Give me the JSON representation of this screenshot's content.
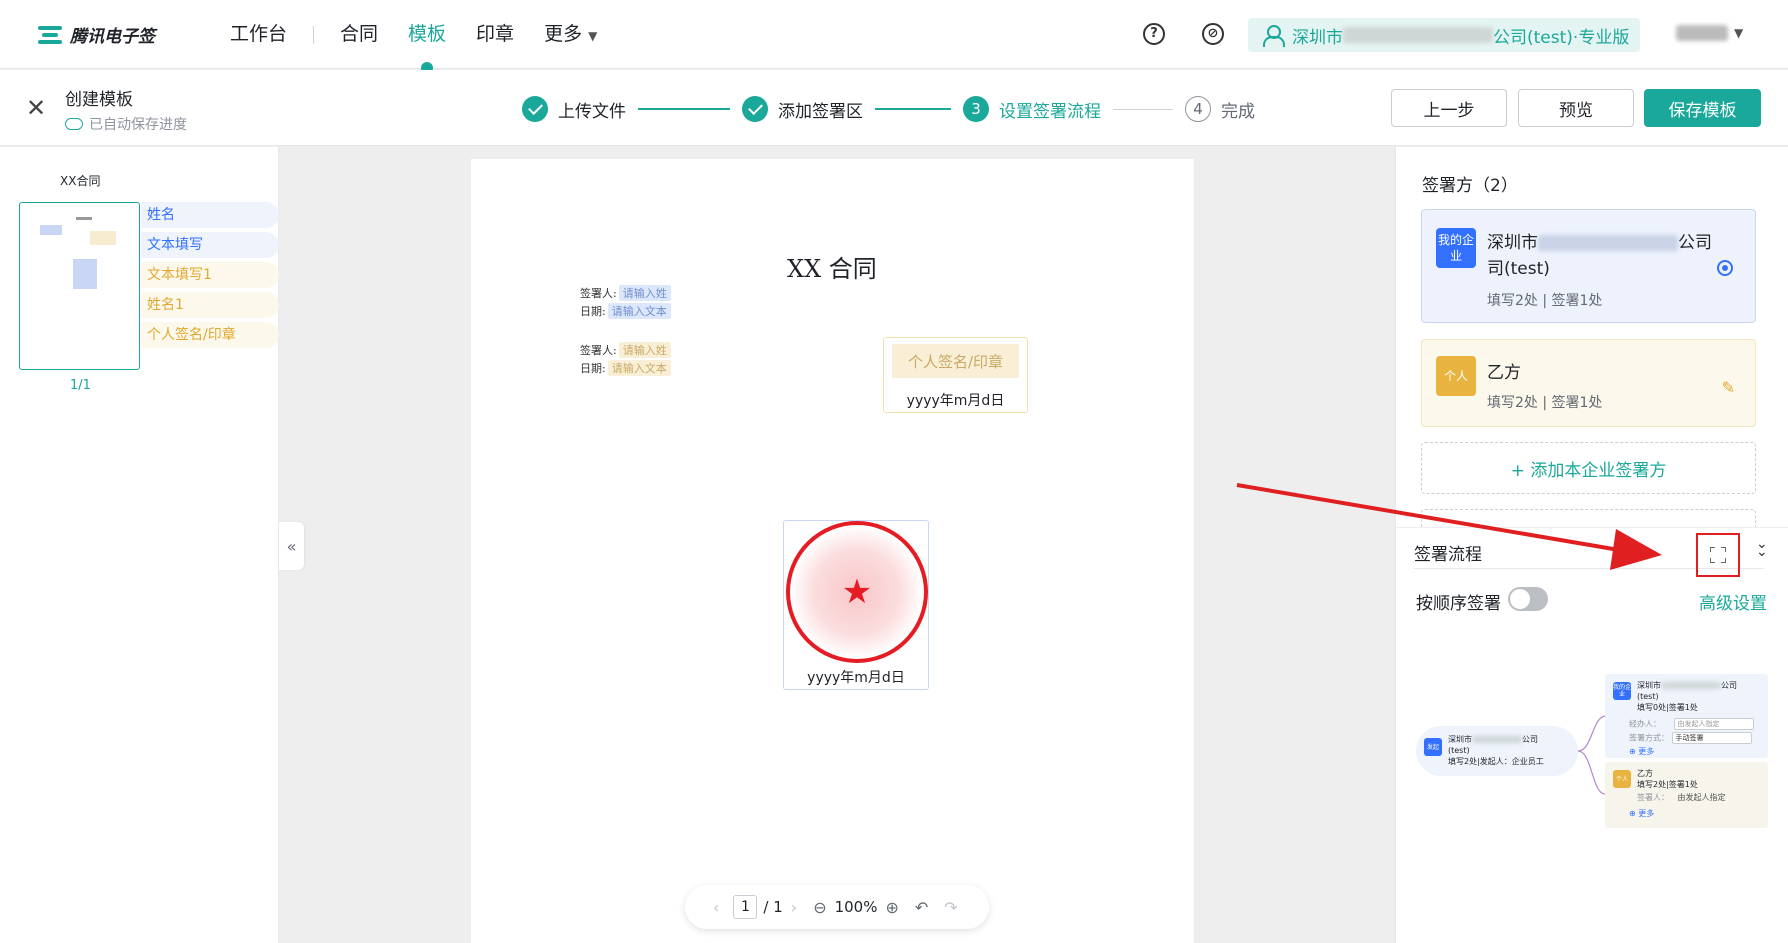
{
  "nav": {
    "logo_text": "腾讯电子签",
    "links": [
      "工作台",
      "合同",
      "模板",
      "印章",
      "更多"
    ],
    "active": "模板",
    "company_prefix": "深圳市",
    "company_suffix": "公司(test)·专业版"
  },
  "subheader": {
    "title": "创建模板",
    "autosave": "已自动保存进度",
    "steps": [
      {
        "num": "",
        "label": "上传文件",
        "state": "done"
      },
      {
        "num": "",
        "label": "添加签署区",
        "state": "done"
      },
      {
        "num": "3",
        "label": "设置签署流程",
        "state": "current"
      },
      {
        "num": "4",
        "label": "完成",
        "state": "todo"
      }
    ],
    "buttons": {
      "prev": "上一步",
      "preview": "预览",
      "save": "保存模板"
    }
  },
  "left": {
    "doc_name": "XX合同",
    "page_count": "1/1",
    "fields": [
      {
        "label": "姓名",
        "color": "blue"
      },
      {
        "label": "文本填写",
        "color": "blue"
      },
      {
        "label": "文本填写1",
        "color": "yellow"
      },
      {
        "label": "姓名1",
        "color": "yellow"
      },
      {
        "label": "个人签名/印章",
        "color": "yellow"
      }
    ]
  },
  "document": {
    "title": "XX 合同",
    "signer_label": "签署人:",
    "date_label": "日期:",
    "name_ph": "请输入姓",
    "text_ph": "请输入文本",
    "sig_box_label": "个人签名/印章",
    "date_format": "yyyy年m月d日",
    "seal_date": "yyyy年m月d日"
  },
  "pager": {
    "current": "1",
    "total": "/ 1",
    "zoom": "100%"
  },
  "right": {
    "title": "签署方（2）",
    "parties": [
      {
        "badge": "我的企业",
        "name_prefix": "深圳市",
        "name_suffix": "公司",
        "name_line2": "司(test)",
        "meta": "填写2处 | 签署1处"
      },
      {
        "badge": "个人",
        "name": "乙方",
        "meta": "填写2处 | 签署1处"
      }
    ],
    "add_button": "+ 添加本企业签署方",
    "flow_title": "签署流程",
    "sequential_label": "按顺序签署",
    "advanced": "高级设置"
  },
  "mini_flow": {
    "start_badge": "发起",
    "start_name_prefix": "深圳市",
    "start_name_suffix": "公司",
    "start_line2": "(test)",
    "start_meta": "填写2处|发起人：企业员工",
    "ent_badge": "我的企业",
    "ent_name_prefix": "深圳市",
    "ent_name_suffix": "公司",
    "ent_line2": "(test)",
    "ent_meta": "填写0处|签署1处",
    "ent_operator_label": "经办人：",
    "ent_operator_value": "由发起人指定",
    "ent_method_label": "签署方式：",
    "ent_method_value": "手动签署",
    "per_badge": "个人",
    "per_name": "乙方",
    "per_meta": "填写2处|签署1处",
    "per_signer_label": "签署人：",
    "per_signer_value": "由发起人指定",
    "more": "更多"
  },
  "colors": {
    "brand": "#1aa89a",
    "blue": "#3370ff",
    "yellow": "#e8b33e",
    "annotation": "#e02020"
  }
}
